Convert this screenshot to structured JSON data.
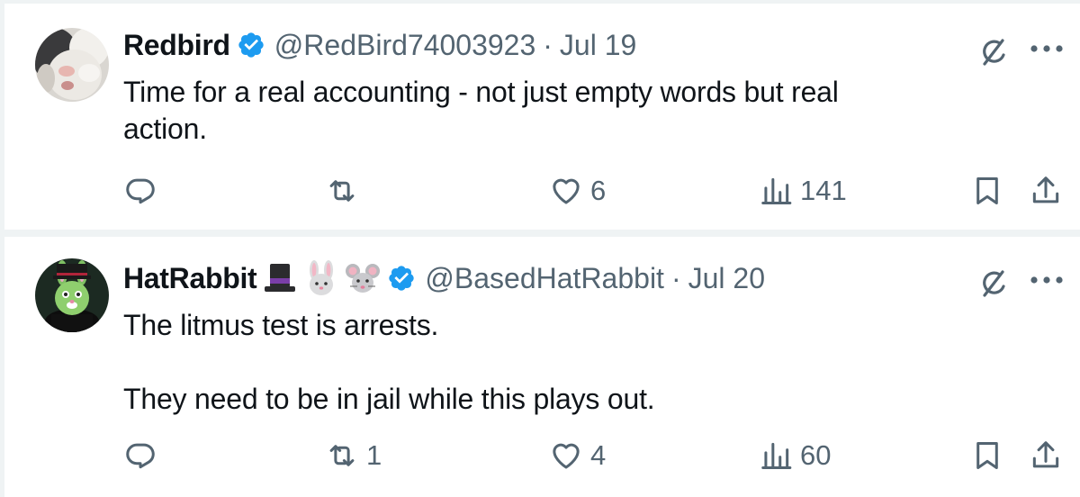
{
  "tweets": [
    {
      "author_name": "Redbird",
      "handle": "@RedBird74003923",
      "separator": "·",
      "date": "Jul 19",
      "text": "Time for a real accounting - not just empty words but real\naction.",
      "reply_count": "",
      "retweet_count": "",
      "like_count": "6",
      "view_count": "141",
      "avatar_icon": "cat-avatar",
      "verified_icon": "verified-badge-icon"
    },
    {
      "author_name": "HatRabbit",
      "handle": "@BasedHatRabbit",
      "separator": "·",
      "date": "Jul 20",
      "text": "The litmus test is arrests.\n\nThey need to be in jail while this plays out.",
      "reply_count": "",
      "retweet_count": "1",
      "like_count": "4",
      "view_count": "60",
      "avatar_icon": "rabbit-in-hat-avatar",
      "name_emojis": [
        "top-hat-emoji",
        "rabbit-face-emoji",
        "mouse-face-emoji"
      ],
      "verified_icon": "verified-badge-icon"
    }
  ],
  "colors": {
    "text_primary": "#0f1419",
    "text_secondary": "#536471",
    "verified_blue": "#1d9bf0",
    "divider": "#eff3f4"
  }
}
